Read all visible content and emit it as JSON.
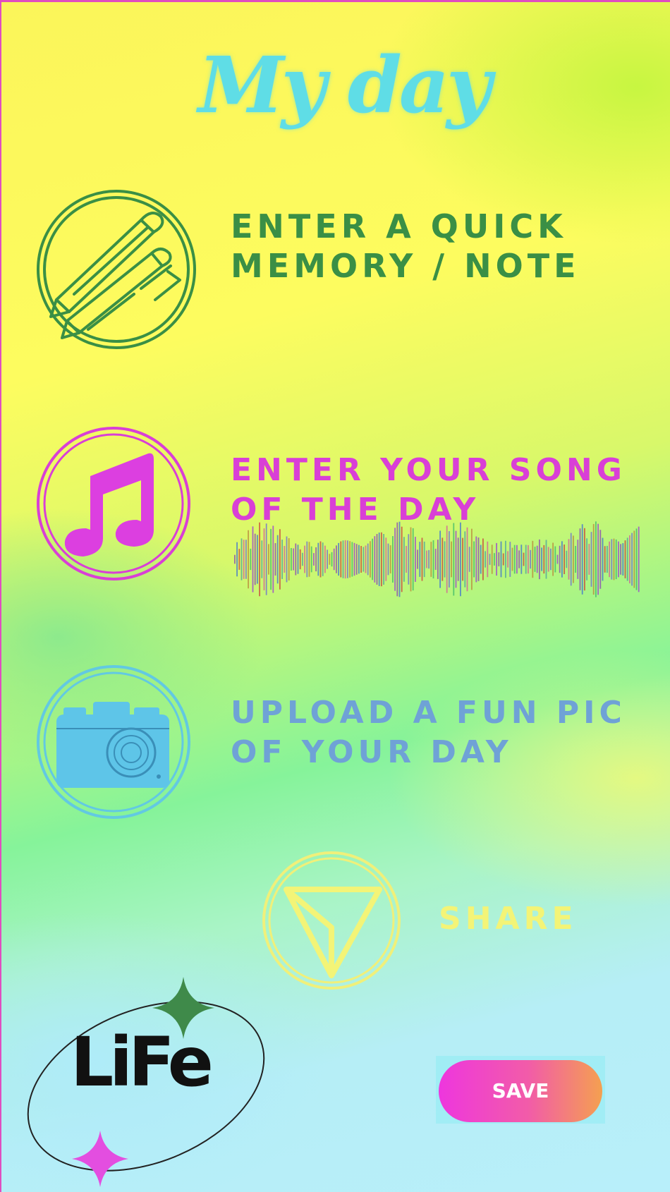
{
  "title": "My day",
  "sections": [
    {
      "label_line1": "ENTER A QUICK",
      "label_line2": "MEMORY / NOTE",
      "icon": "pencil-icon",
      "color": "#3a8f45"
    },
    {
      "label_line1": "ENTER YOUR SONG",
      "label_line2": "OF THE DAY",
      "icon": "music-note-icon",
      "color": "#d93fd6"
    },
    {
      "label_line1": "UPLOAD A FUN PIC",
      "label_line2": "OF YOUR DAY",
      "icon": "camera-icon",
      "color": "#6fa2d6"
    }
  ],
  "share": {
    "label": "SHARE",
    "icon": "send-icon",
    "color": "#f3f477"
  },
  "logo": {
    "text": "LiFe"
  },
  "save_button": {
    "label": "SAVE"
  },
  "colors": {
    "title": "#5fdde6",
    "save_start": "#ee36de",
    "save_end": "#f4a050",
    "sparkle_green": "#3f8a4a",
    "sparkle_magenta": "#e34ee0"
  }
}
